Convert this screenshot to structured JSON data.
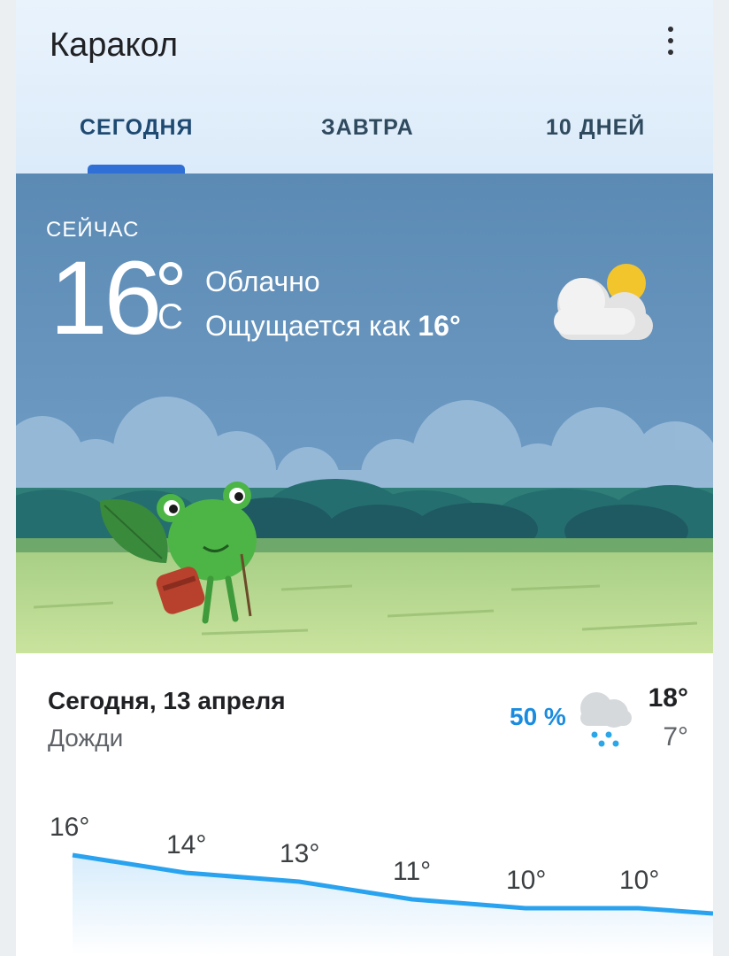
{
  "header": {
    "city": "Каракол",
    "tabs": [
      "СЕГОДНЯ",
      "ЗАВТРА",
      "10 ДНЕЙ"
    ],
    "active_tab": 0
  },
  "current": {
    "label": "СЕЙЧАС",
    "temperature": "16",
    "unit": "C",
    "condition": "Облачно",
    "feels_like_prefix": "Ощущается как",
    "feels_like_value": "16°",
    "icon": "partly-cloudy-icon"
  },
  "today": {
    "title": "Сегодня, 13 апреля",
    "condition": "Дожди",
    "precipitation": "50 %",
    "high": "18°",
    "low": "7°",
    "icon": "rain-cloud-icon"
  },
  "hourly": {
    "labels": [
      "16°",
      "14°",
      "13°",
      "11°",
      "10°",
      "10°"
    ],
    "values": [
      16,
      14,
      13,
      11,
      10,
      10
    ],
    "line_color": "#29a3ef"
  },
  "colors": {
    "accent": "#2f6fd6",
    "precip": "#1a8ce0",
    "sky": "#5f8eb8"
  }
}
